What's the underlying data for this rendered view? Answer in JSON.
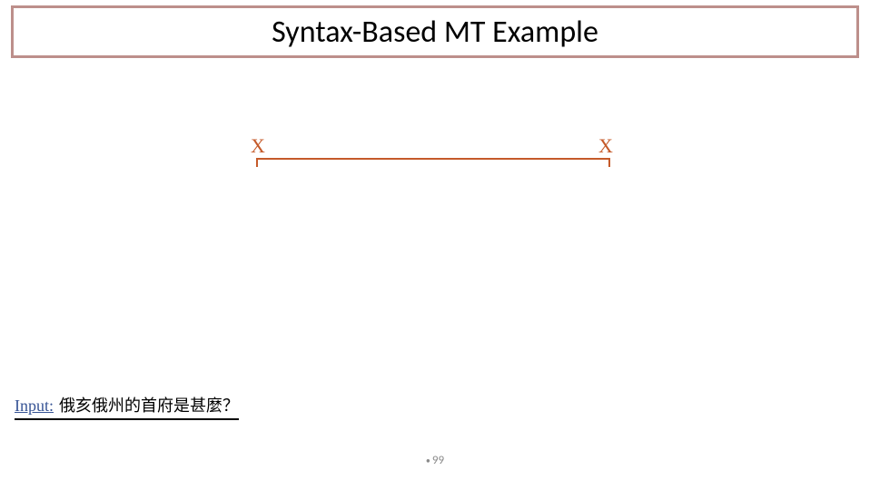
{
  "title": "Syntax-Based MT Example",
  "nodes": {
    "left_label": "X",
    "right_label": "X"
  },
  "input": {
    "label": "Input:",
    "sentence": "俄亥俄州的首府是甚麼？"
  },
  "footer": {
    "page_number": "99"
  }
}
